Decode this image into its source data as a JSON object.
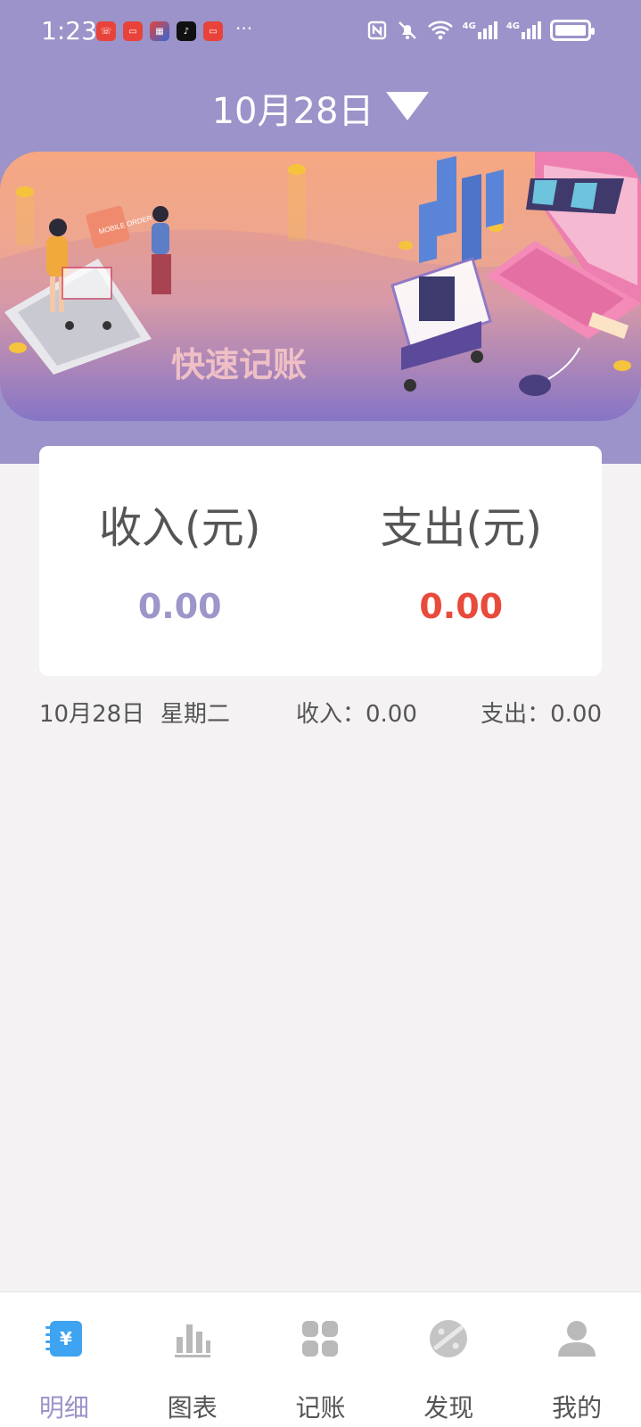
{
  "status_bar": {
    "time": "1:23",
    "dots": "···",
    "network_labels": [
      "4G",
      "4G"
    ]
  },
  "header": {
    "date": "10月28日"
  },
  "banner": {
    "title": "快速记账",
    "sign_text": "MOBILE ORDER"
  },
  "summary": {
    "income_label": "收入(元)",
    "income_value": "0.00",
    "expense_label": "支出(元)",
    "expense_value": "0.00"
  },
  "day_summary": {
    "date": "10月28日",
    "weekday": "星期二",
    "income": "收入：0.00",
    "expense": "支出：0.00"
  },
  "tabs": [
    {
      "label": "明细",
      "icon": "ledger-icon",
      "active": true
    },
    {
      "label": "图表",
      "icon": "chart-icon",
      "active": false
    },
    {
      "label": "记账",
      "icon": "grid-icon",
      "active": false
    },
    {
      "label": "发现",
      "icon": "palette-icon",
      "active": false
    },
    {
      "label": "我的",
      "icon": "person-icon",
      "active": false
    }
  ],
  "colors": {
    "accent": "#9b93c9",
    "expense": "#e84a3c",
    "background": "#f4f2f2"
  }
}
